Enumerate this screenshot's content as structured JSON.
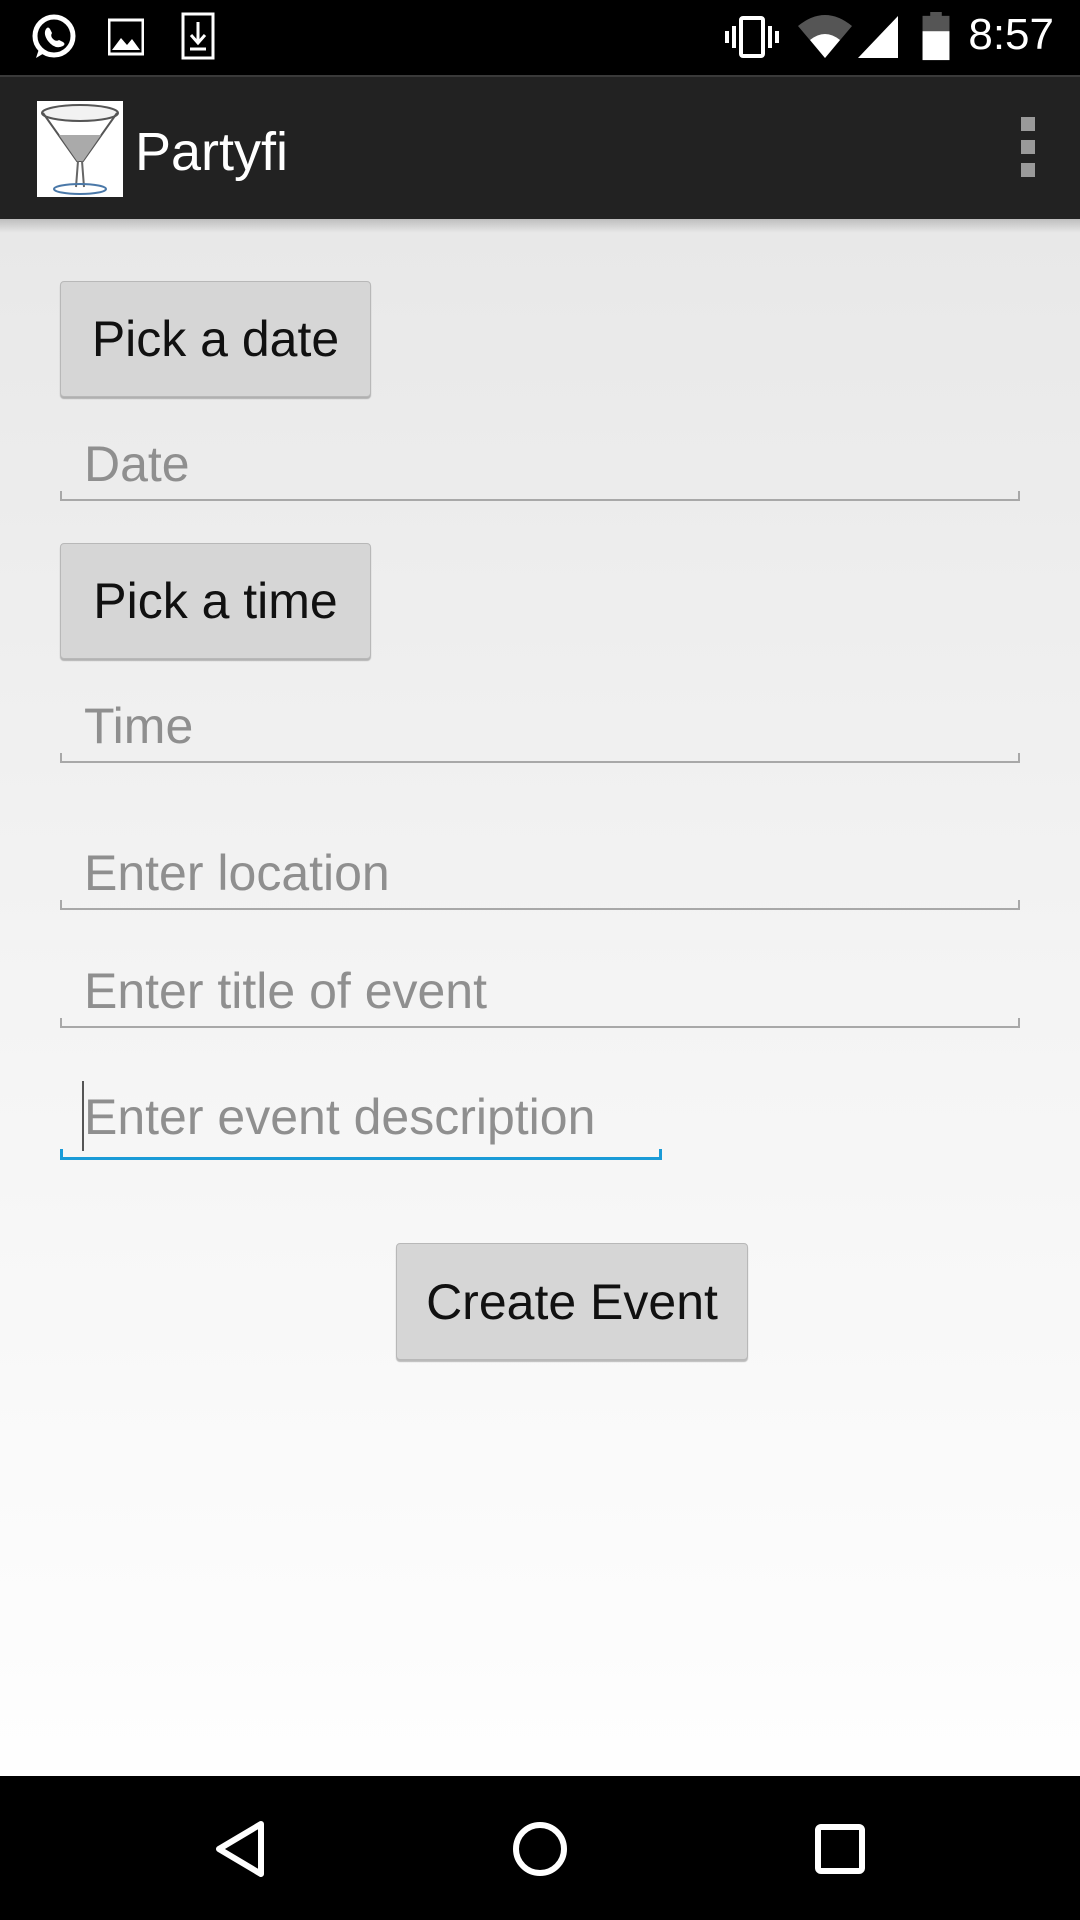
{
  "status_bar": {
    "notification_icons": [
      "whatsapp-icon",
      "image-icon",
      "download-icon"
    ],
    "system_icons": [
      "vibrate-icon",
      "wifi-icon",
      "signal-icon",
      "battery-icon"
    ],
    "time": "8:57"
  },
  "action_bar": {
    "title": "Partyfi",
    "logo_icon": "cocktail-glass-icon",
    "menu_icon": "overflow-menu-icon"
  },
  "form": {
    "pick_date_label": "Pick a date",
    "date_placeholder": "Date",
    "pick_time_label": "Pick a time",
    "time_placeholder": "Time",
    "location_placeholder": "Enter location",
    "title_placeholder": "Enter title of event",
    "description_placeholder": "Enter event description",
    "create_label": "Create Event"
  },
  "colors": {
    "accent": "#1a9bd7",
    "action_bar": "#222222",
    "button": "#d6d6d6"
  },
  "nav_bar": {
    "icons": [
      "back-icon",
      "home-icon",
      "recents-icon"
    ]
  }
}
